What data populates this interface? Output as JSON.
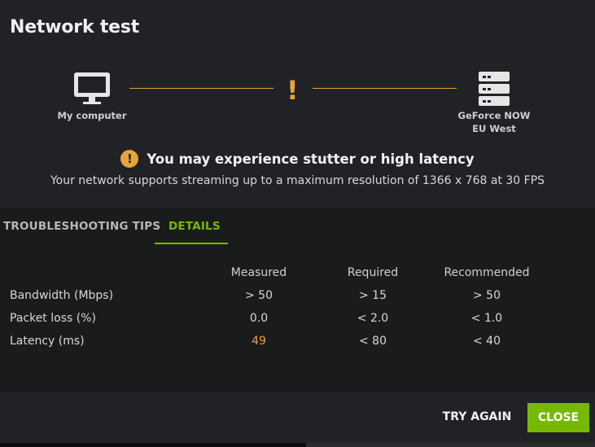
{
  "dialog": {
    "title": "Network test"
  },
  "diagram": {
    "left_label": "My computer",
    "left_icon": "monitor-icon",
    "right_label_line1": "GeForce NOW",
    "right_label_line2": "EU West",
    "right_icon": "server-icon",
    "status_symbol": "!",
    "status_color": "#e8a33a"
  },
  "warning": {
    "icon_symbol": "!",
    "title": "You may experience stutter or high latency",
    "subtitle": "Your network supports streaming up to a maximum resolution of 1366 x 768 at 30 FPS"
  },
  "tabs": [
    {
      "label": "TROUBLESHOOTING TIPS",
      "active": false
    },
    {
      "label": "DETAILS",
      "active": true
    }
  ],
  "details_table": {
    "headers": [
      "",
      "Measured",
      "Required",
      "Recommended"
    ],
    "rows": [
      {
        "label": "Bandwidth (Mbps)",
        "measured": "> 50",
        "required": "> 15",
        "recommended": "> 50"
      },
      {
        "label": "Packet loss (%)",
        "measured": "0.0",
        "required": "< 2.0",
        "recommended": "< 1.0"
      },
      {
        "label": "Latency (ms)",
        "measured": "49",
        "required": "< 80",
        "recommended": "< 40"
      }
    ]
  },
  "footer": {
    "try_again_label": "TRY AGAIN",
    "close_label": "CLOSE"
  },
  "colors": {
    "accent": "#76b900",
    "warning": "#e8a33a",
    "panel": "#202225",
    "background": "#1a1b1c"
  }
}
